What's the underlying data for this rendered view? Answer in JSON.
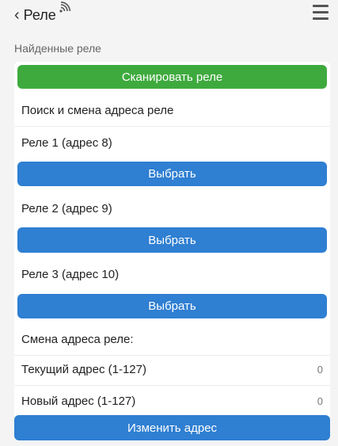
{
  "header": {
    "back_label": "Реле",
    "back_icon": "chevron-left-icon",
    "signal_icon": "wifi-signal-icon",
    "menu_icon": "hamburger-menu-icon"
  },
  "section_title": "Найденные реле",
  "scan_button": "Сканировать реле",
  "search_heading": "Поиск и смена адреса реле",
  "relays": [
    {
      "label": "Реле 1 (адрес 8)",
      "button": "Выбрать"
    },
    {
      "label": "Реле 2 (адрес 9)",
      "button": "Выбрать"
    },
    {
      "label": "Реле 3 (адрес 10)",
      "button": "Выбрать"
    }
  ],
  "address_change": {
    "heading": "Смена адреса реле:",
    "current_label": "Текущий адрес (1-127)",
    "current_value": "0",
    "new_label": "Новый адрес (1-127)",
    "new_value": "0",
    "submit": "Изменить адрес"
  },
  "colors": {
    "green": "#3eaa3e",
    "blue": "#2f7fd2"
  }
}
